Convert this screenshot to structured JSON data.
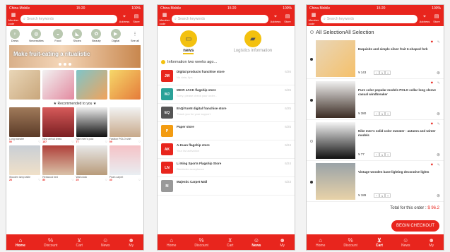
{
  "status": {
    "carrier": "China Mobile",
    "time": "15:20",
    "battery": "100%"
  },
  "topbar": {
    "member_label": "Member code",
    "search_placeholder": "Search keywords",
    "address_label": "Address",
    "store_label": "Store"
  },
  "tabbar": [
    {
      "label": "Home",
      "icon": "home-icon"
    },
    {
      "label": "Discount",
      "icon": "discount-icon"
    },
    {
      "label": "Cart",
      "icon": "cart-icon"
    },
    {
      "label": "News",
      "icon": "news-icon"
    },
    {
      "label": "My",
      "icon": "user-icon"
    }
  ],
  "home": {
    "categories": [
      "Dress",
      "Necessities",
      "Food",
      "Shoes",
      "Beauty",
      "Digital",
      "See all"
    ],
    "banner_text": "Make fruit-eating a ritualistic",
    "recommend_label": "Recommended to you",
    "products": [
      {
        "name": "Long sweater",
        "price": "50"
      },
      {
        "name": "New arrival dress",
        "price": "157"
      },
      {
        "name": "Nike men's polo",
        "price": "77"
      },
      {
        "name": "Fashion POLO shirt",
        "price": "59"
      },
      {
        "name": "Wooden lamp table",
        "price": "26"
      },
      {
        "name": "Redwood bed",
        "price": "80"
      },
      {
        "name": "Wall clock",
        "price": "25"
      },
      {
        "name": "Plush carpet",
        "price": "40"
      }
    ]
  },
  "news": {
    "tabs": [
      {
        "label": "news",
        "icon": "chat-icon"
      },
      {
        "label": "Logistics information",
        "icon": "truck-icon"
      }
    ],
    "header": "Information two weeks ago...",
    "messages": [
      {
        "title": "Digital products franchise store",
        "sub": "No data, tips",
        "date": "6/26",
        "logo": "JM",
        "color": "#e8251d"
      },
      {
        "title": "MICR JACK flagship store",
        "sub": "Sorry, please check your order...",
        "date": "6/26",
        "logo": "MJ",
        "color": "#2aa198"
      },
      {
        "title": "EnQiYuAN digital franchise store",
        "sub": "Thank you for your support",
        "date": "6/25",
        "logo": "EQ",
        "color": "#555555"
      },
      {
        "title": "Paper store",
        "sub": "",
        "date": "6/25",
        "logo": "P",
        "color": "#f39c12"
      },
      {
        "title": "A-Kuan flagship store",
        "sub": "Your list activation",
        "date": "6/24",
        "logo": "AK",
        "color": "#e8251d"
      },
      {
        "title": "Li Ning Sports Flagship Store",
        "sub": "Reminder acceptance",
        "date": "6/24",
        "logo": "LN",
        "color": "#e8251d"
      },
      {
        "title": "Majestic Carpet Mall",
        "sub": "",
        "date": "6/23",
        "logo": "M",
        "color": "#999999"
      }
    ]
  },
  "cart": {
    "header": "All SelectionAll Selection",
    "items": [
      {
        "name": "Exquisite and simple silver fruit 6-shaped fork",
        "price": "¥ 143",
        "qty": "1",
        "checked": true
      },
      {
        "name": "Pure color popular models POLO collar long sleeve casual windbreaker",
        "price": "¥ 380",
        "qty": "1",
        "checked": true
      },
      {
        "name": "Nike men's solid color sweater - autumn and winter models",
        "price": "¥ 77",
        "qty": "1",
        "checked": false
      },
      {
        "name": "Vintage wooden base lighting decorative lights",
        "price": "¥ 189",
        "qty": "1",
        "checked": true
      }
    ],
    "total_label": "Total for this order :",
    "total_value": "$ 96.2",
    "checkout_label": "BEGIN CHECKOUT"
  },
  "colors": {
    "brand_red": "#e8251d",
    "accent_yellow": "#f3c10f"
  }
}
